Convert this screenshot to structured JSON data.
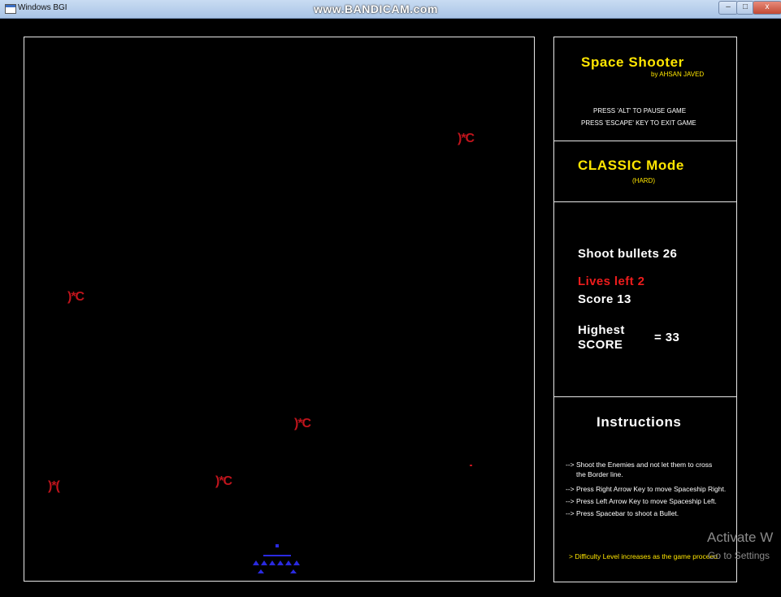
{
  "window": {
    "title": "Windows BGI",
    "watermark": "www.BANDICAM.com",
    "controls": {
      "minimize": "–",
      "maximize": "□",
      "close": "x"
    }
  },
  "game": {
    "enemies": [
      {
        "glyph": ")*C"
      },
      {
        "glyph": ")*C"
      },
      {
        "glyph": ")*C"
      },
      {
        "glyph": ")*C"
      },
      {
        "glyph": ")*("
      }
    ],
    "ship_icon": "spaceship-icon",
    "colors": {
      "enemy": "#c0141c",
      "ship": "#2a2ae0",
      "border": "#e8e8e8"
    }
  },
  "panel": {
    "title": "Space Shooter",
    "author": "by AHSAN JAVED",
    "pause_hint": "PRESS 'ALT' TO PAUSE GAME",
    "exit_hint": "PRESS 'ESCAPE' KEY TO EXIT GAME",
    "mode": "CLASSIC Mode",
    "difficulty": "(HARD)",
    "shoot_bullets": "Shoot bullets 26",
    "lives_left": "Lives left 2",
    "score": "Score 13",
    "highest_label_1": "Highest",
    "highest_label_2": "SCORE",
    "highest_value": "= 33",
    "instructions_title": "Instructions",
    "instructions": [
      "--> Shoot the Enemies and not let them to cross",
      "the Border line.",
      "--> Press Right Arrow Key to move Spaceship Right.",
      "--> Press Left Arrow Key to move Spaceship Left.",
      "--> Press Spacebar to shoot a Bullet."
    ],
    "difficulty_note": "> Difficulty Level increases as the game proceed",
    "colors": {
      "title": "#ffe600",
      "lives": "#ee1c1c",
      "text": "#ffffff"
    }
  },
  "overlay": {
    "activate": "Activate W",
    "settings": "Go to Settings"
  }
}
